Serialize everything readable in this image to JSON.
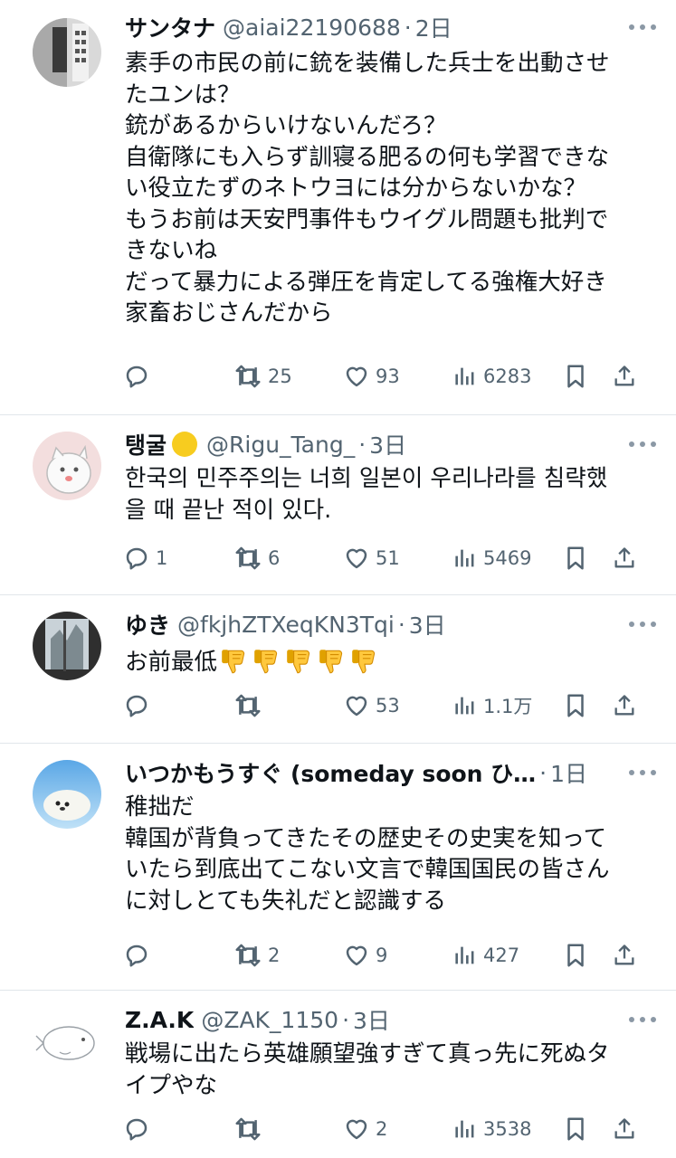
{
  "tweets": [
    {
      "name": "サンタナ",
      "handle": "@aiai22190688",
      "time": "2日",
      "lines": [
        "素手の市民の前に銃を装備した兵士を出動させ",
        "たユンは？",
        "銃があるからいけないんだろ？",
        "自衛隊にも入らず訓寝る肥るの何も学習できな",
        "い役立たずのネトウヨには分からないかな？",
        "もうお前は天安門事件もウイグル問題も批判で",
        "きないね",
        "だって暴力による弾圧を肯定してる強権大好き",
        "家畜おじさんだから"
      ],
      "replies": "",
      "retweets": "25",
      "likes": "93",
      "views": "6283"
    },
    {
      "name": "탱굴",
      "handle": "@Rigu_Tang_",
      "time": "3日",
      "lines": [
        "한국의 민주주의는 너희 일본이 우리나라를 침략했",
        "을 때 끝난 적이 있다."
      ],
      "replies": "1",
      "retweets": "6",
      "likes": "51",
      "views": "5469"
    },
    {
      "name": "ゆき",
      "handle": "@fkjhZTXeqKN3Tqi",
      "time": "3日",
      "lines": [
        "お前最低"
      ],
      "emoji_count": 5,
      "replies": "",
      "retweets": "",
      "likes": "53",
      "views": "1.1万"
    },
    {
      "name": "いつかもうすぐ (someday soon ひ…",
      "handle": "",
      "time": "1日",
      "lines": [
        "稚拙だ",
        "韓国が背負ってきたその歴史その史実を知って",
        "いたら到底出てこない文言で韓国国民の皆さん",
        "に対しとても失礼だと認識する"
      ],
      "replies": "",
      "retweets": "2",
      "likes": "9",
      "views": "427"
    },
    {
      "name": "Z.A.K",
      "handle": "@ZAK_1150",
      "time": "3日",
      "lines": [
        "戦場に出たら英雄願望強すぎて真っ先に死ぬタ",
        "イプやな"
      ],
      "replies": "",
      "retweets": "",
      "likes": "2",
      "views": "3538"
    }
  ],
  "colors": {
    "text": "#0f1419",
    "secondary": "#536471",
    "divider": "#e1e6ea",
    "accent": "#f2c319"
  },
  "icons": [
    "reply-icon",
    "retweet-icon",
    "like-icon",
    "views-icon",
    "bookmark-icon",
    "share-icon",
    "more-icon",
    "thumbs-down-emoji",
    "yellow-circle-emoji"
  ]
}
